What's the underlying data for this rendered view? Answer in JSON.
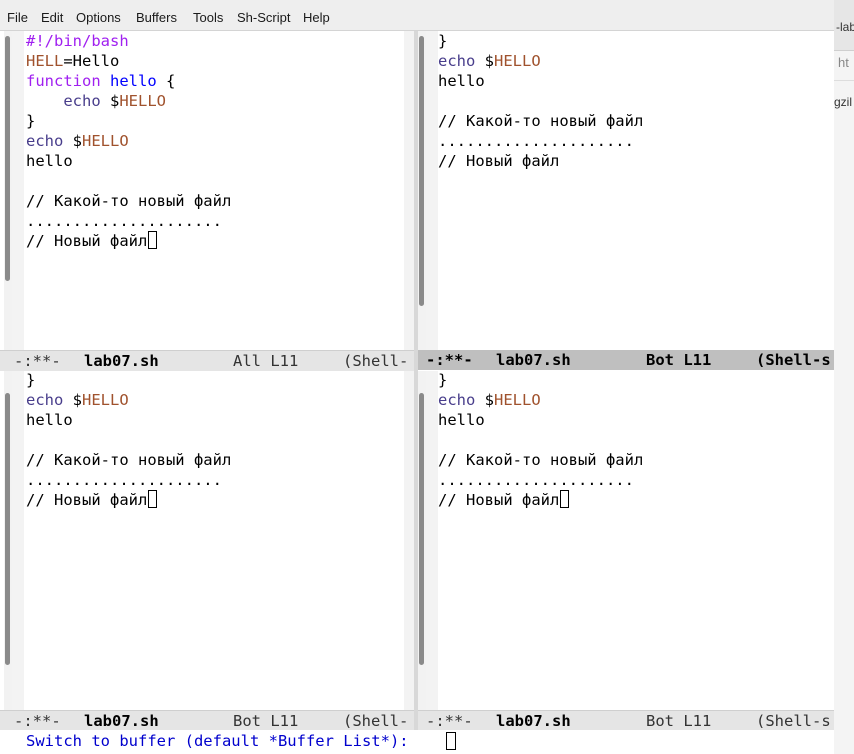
{
  "menu": [
    "File",
    "Edit",
    "Options",
    "Buffers",
    "Tools",
    "Sh-Script",
    "Help"
  ],
  "background_app": {
    "tab_fragment": "-lab",
    "url_fragment": "ht",
    "bookmark_fragment": "gzil"
  },
  "code": {
    "shebang": "#!/bin/bash",
    "assign_var": "HELL",
    "assign_eq": "=",
    "assign_val": "Hello",
    "kw_function": "function",
    "fn_name": "hello",
    "brace_open": " {",
    "indent": "    ",
    "kw_echo": "echo",
    "dollar": " $",
    "var_hello": "HELLO",
    "brace_close": "}",
    "plain_hello": "hello",
    "comment1": "// Какой-то новый файл",
    "dots": ".....................",
    "comment2": "// Новый файл"
  },
  "windows": {
    "top_left": {
      "mode_flags": "-:**-",
      "buffer_name": "lab07.sh",
      "position": "All L11",
      "major_mode": "(Shell-"
    },
    "top_right": {
      "mode_flags": "-:**-",
      "buffer_name": "lab07.sh",
      "position": "Bot L11",
      "major_mode": "(Shell-s"
    },
    "bottom_left": {
      "mode_flags": "-:**-",
      "buffer_name": "lab07.sh",
      "position": "Bot L11",
      "major_mode": "(Shell-"
    },
    "bottom_right": {
      "mode_flags": "-:**-",
      "buffer_name": "lab07.sh",
      "position": "Bot L11",
      "major_mode": "(Shell-s"
    }
  },
  "minibuffer": {
    "prompt": "Switch to buffer (default *Buffer List*): "
  },
  "colors": {
    "keyword": "#a020f0",
    "function_name": "#0000ff",
    "variable": "#a0522d",
    "builtin": "#483d8b",
    "minibuffer_prompt": "#0000cd"
  }
}
